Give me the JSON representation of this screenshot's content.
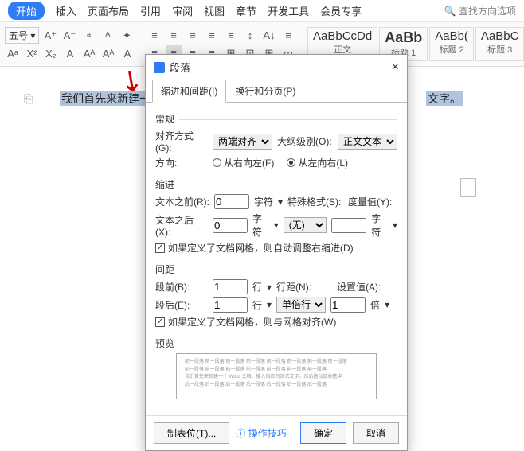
{
  "menu": {
    "tabs": [
      "开始",
      "插入",
      "页面布局",
      "引用",
      "审阅",
      "视图",
      "章节",
      "开发工具",
      "会员专享"
    ],
    "search": "查找方向选项"
  },
  "ribbon": {
    "fontsize": "五号",
    "row1": [
      "A⁺",
      "A⁻",
      "ᵃ",
      "ᴬ",
      "✦"
    ],
    "row2": [
      "Aᵃ",
      "X²",
      "X₂",
      "A",
      "Aᴬ",
      "Aᴬ",
      "A"
    ],
    "para1": [
      "≡",
      "≡",
      "≡",
      "≡",
      "≡",
      "↕",
      "A↓",
      "≡"
    ],
    "para2": [
      "≡",
      "≡",
      "≡",
      "≡",
      "⊞",
      "⊡",
      "⊞",
      "⋯"
    ]
  },
  "styles": [
    {
      "preview": "AaBbCcDd",
      "label": "正文",
      "big": false
    },
    {
      "preview": "AaBb",
      "label": "标题 1",
      "big": true
    },
    {
      "preview": "AaBb(",
      "label": "标题 2",
      "big": false
    },
    {
      "preview": "AaBbC",
      "label": "标题 3",
      "big": false
    }
  ],
  "doc": {
    "before": "我们首先来新建一",
    "after": "文字。"
  },
  "dialog": {
    "title": "段落",
    "tabs": [
      "缩进和间距(I)",
      "换行和分页(P)"
    ],
    "general": {
      "title": "常规",
      "align_label": "对齐方式(G):",
      "align_value": "两端对齐",
      "outline_label": "大纲级别(O):",
      "outline_value": "正文文本",
      "dir_label": "方向:",
      "dir_ltr": "从右向左(F)",
      "dir_rtl": "从左向右(L)"
    },
    "indent": {
      "title": "缩进",
      "before_label": "文本之前(R):",
      "before_val": "0",
      "after_label": "文本之后(X):",
      "after_val": "0",
      "unit": "字符",
      "special_label": "特殊格式(S):",
      "special_val": "(无)",
      "by_label": "度量值(Y):",
      "by_unit": "字符",
      "auto": "如果定义了文档网格，则自动调整右缩进(D)"
    },
    "spacing": {
      "title": "间距",
      "before_label": "段前(B):",
      "before_val": "1",
      "after_label": "段后(E):",
      "after_val": "1",
      "unit": "行",
      "line_label": "行距(N):",
      "line_val": "单倍行距",
      "at_label": "设置值(A):",
      "at_val": "1",
      "at_unit": "倍",
      "snap": "如果定义了文档网格，则与网格对齐(W)"
    },
    "preview": {
      "title": "预览"
    },
    "footer": {
      "tabs": "制表位(T)...",
      "tips": "操作技巧",
      "ok": "确定",
      "cancel": "取消"
    }
  }
}
